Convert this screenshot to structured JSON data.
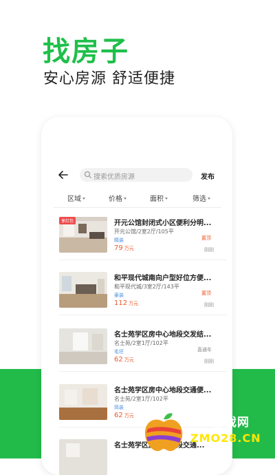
{
  "hero": {
    "title": "找房子",
    "subtitle": "安心房源 舒适便捷"
  },
  "toolbar": {
    "search_placeholder": "搜索优质房源",
    "publish_label": "发布"
  },
  "filters": [
    "区域",
    "价格",
    "面积",
    "筛选"
  ],
  "listings": [
    {
      "badge": "享红包",
      "title": "开元公馆封闭式小区便利分明...",
      "meta": "开元公馆/2室2厅/105平",
      "decoration": "精装",
      "price": "79",
      "unit": "万元",
      "tag": "置顶",
      "time": "刚刚"
    },
    {
      "badge": "",
      "title": "和平现代城南向户型好位方便...",
      "meta": "和平现代城/3室2厅/143平",
      "decoration": "豪装",
      "price": "112",
      "unit": "万元",
      "tag": "置顶",
      "time": "刚刚"
    },
    {
      "badge": "",
      "title": "名士苑学区房中心地段交发结...",
      "meta": "名士苑/2室1厅/102平",
      "decoration": "毛坯",
      "price": "62",
      "unit": "万元",
      "tag": "直通车",
      "time": "刚刚"
    },
    {
      "badge": "",
      "title": "名士苑学区房中心地段交通便...",
      "meta": "名士苑/2室1厅/102平",
      "decoration": "简装",
      "price": "62",
      "unit": "万元",
      "tag": "",
      "time": ""
    },
    {
      "badge": "",
      "title": "名士苑学区房中心地段交通...",
      "meta": "",
      "decoration": "",
      "price": "",
      "unit": "",
      "tag": "",
      "time": ""
    }
  ],
  "watermark": {
    "text": "知东游戏网",
    "url": "ZMO28.CN"
  },
  "colors": {
    "brand_green": "#1fbf4a",
    "price_orange": "#e85a2a",
    "tag_red": "#ee4c4c",
    "decor_blue": "#4a90e2"
  }
}
